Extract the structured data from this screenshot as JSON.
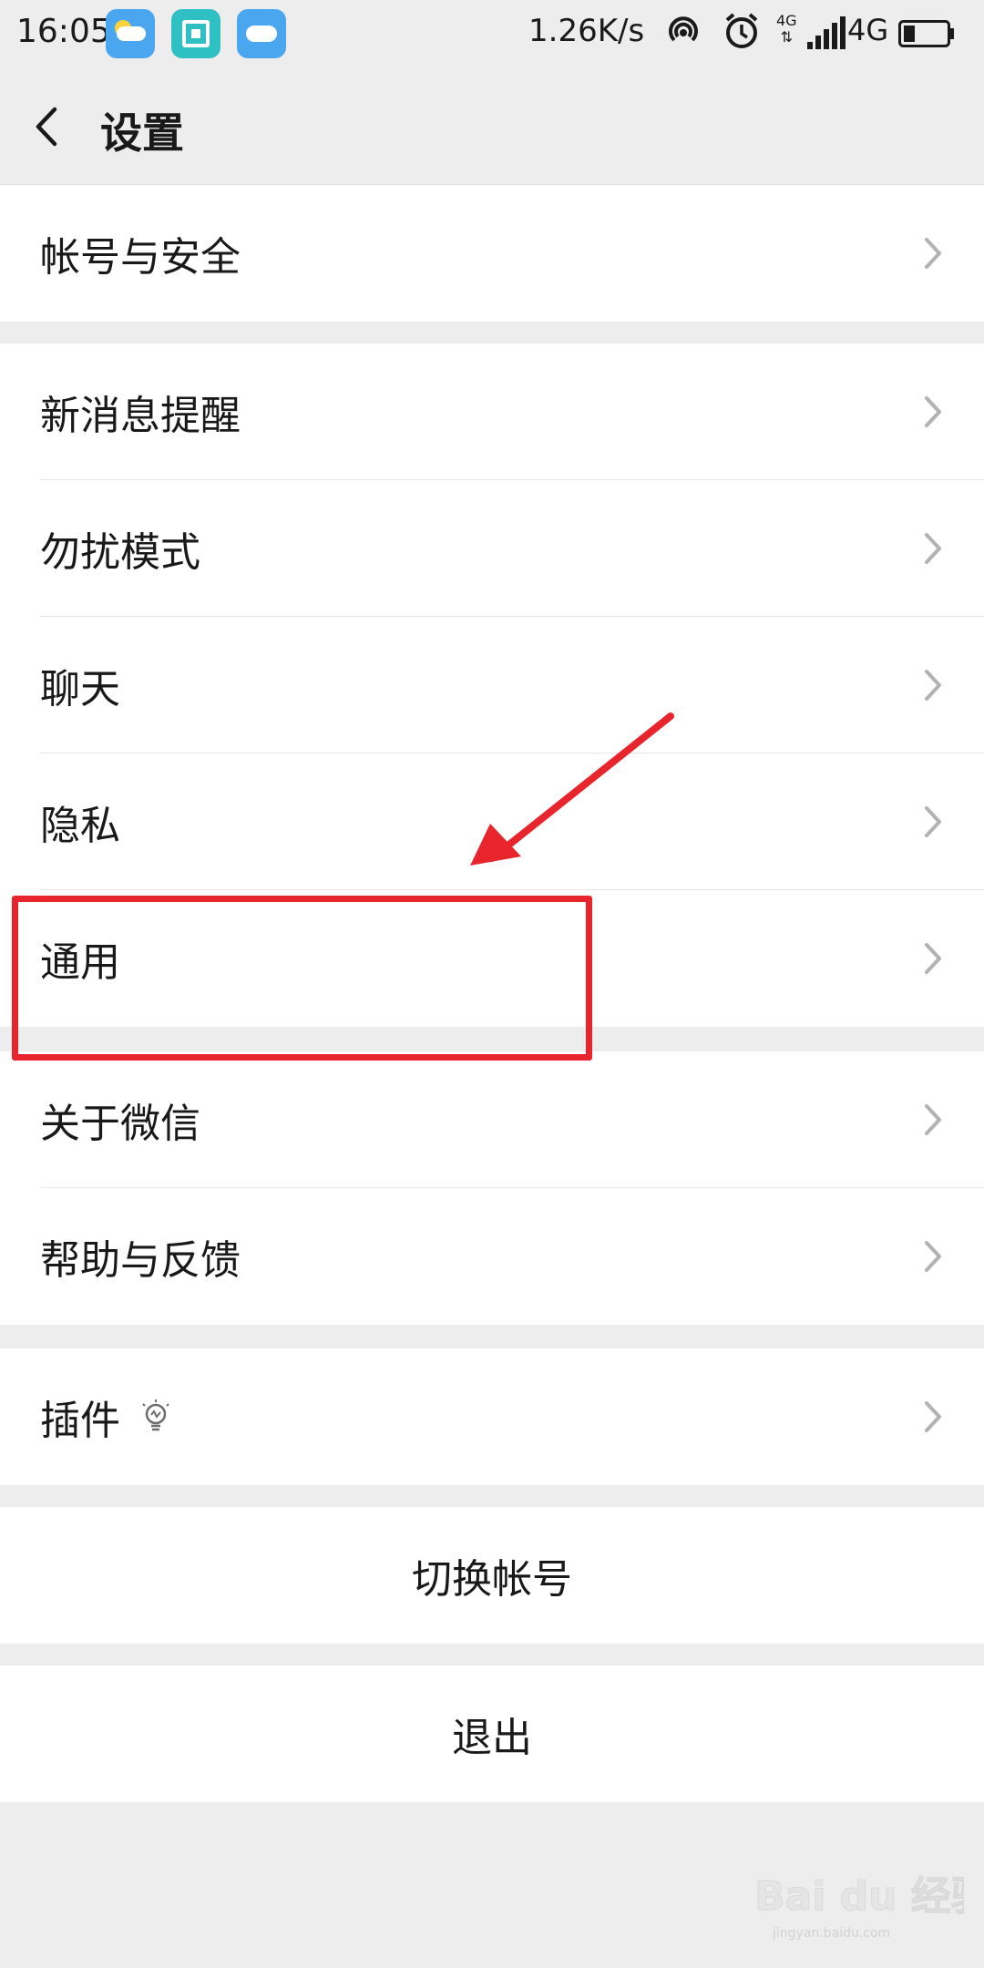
{
  "status_bar": {
    "time": "16:05",
    "speed": "1.26K/s",
    "network_small": "4G",
    "network": "4G",
    "icons": [
      "weather-icon",
      "scan-icon",
      "weather-icon",
      "hotspot-icon",
      "alarm-icon",
      "signal-icon",
      "battery-icon"
    ]
  },
  "nav": {
    "title": "设置",
    "back_icon": "chevron-left-icon"
  },
  "groups": [
    {
      "items": [
        {
          "label": "帐号与安全"
        }
      ]
    },
    {
      "items": [
        {
          "label": "新消息提醒"
        },
        {
          "label": "勿扰模式"
        },
        {
          "label": "聊天"
        },
        {
          "label": "隐私"
        },
        {
          "label": "通用"
        }
      ]
    },
    {
      "items": [
        {
          "label": "关于微信"
        },
        {
          "label": "帮助与反馈"
        }
      ]
    },
    {
      "items": [
        {
          "label": "插件",
          "icon": "lightbulb-icon"
        }
      ]
    }
  ],
  "actions": {
    "switch_account": "切换帐号",
    "logout": "退出"
  },
  "annotation": {
    "highlighted_item": "通用",
    "color": "#e8242d"
  },
  "watermark": {
    "brand": "Bai du 经验",
    "url": "jingyan.baidu.com"
  },
  "colors": {
    "background": "#ededed",
    "card": "#ffffff",
    "text": "#191919",
    "chevron": "#b2b2b2"
  }
}
